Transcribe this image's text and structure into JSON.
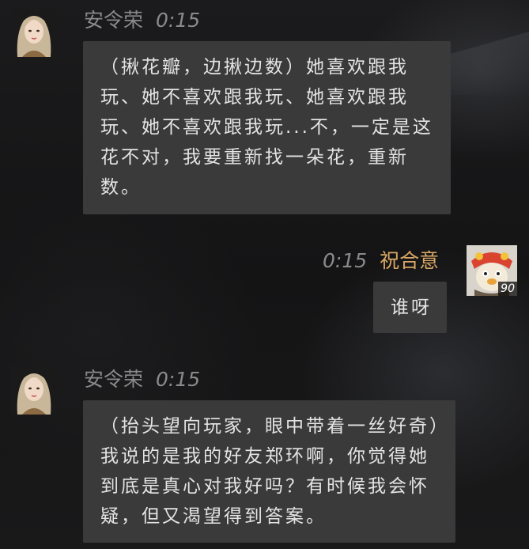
{
  "messages": [
    {
      "sender": "安令荣",
      "time": "0:15",
      "text": "（揪花瓣，边揪边数）她喜欢跟我玩、她不喜欢跟我玩、她喜欢跟我玩、她不喜欢跟我玩...不，一定是这花不对，我要重新找一朵花，重新数。"
    },
    {
      "sender": "祝合意",
      "time": "0:15",
      "text": "谁呀",
      "avatar_badge": "90"
    },
    {
      "sender": "安令荣",
      "time": "0:15",
      "text": "（抬头望向玩家，眼中带着一丝好奇）我说的是我的好友郑环啊，你觉得她到底是真心对我好吗？有时候我会怀疑，但又渴望得到答案。"
    }
  ],
  "colors": {
    "background": "#151516",
    "bubble": "#3a3a3b",
    "bubble_text": "#e4e4e4",
    "other_name": "#8a8a8c",
    "self_name": "#d9a866"
  }
}
